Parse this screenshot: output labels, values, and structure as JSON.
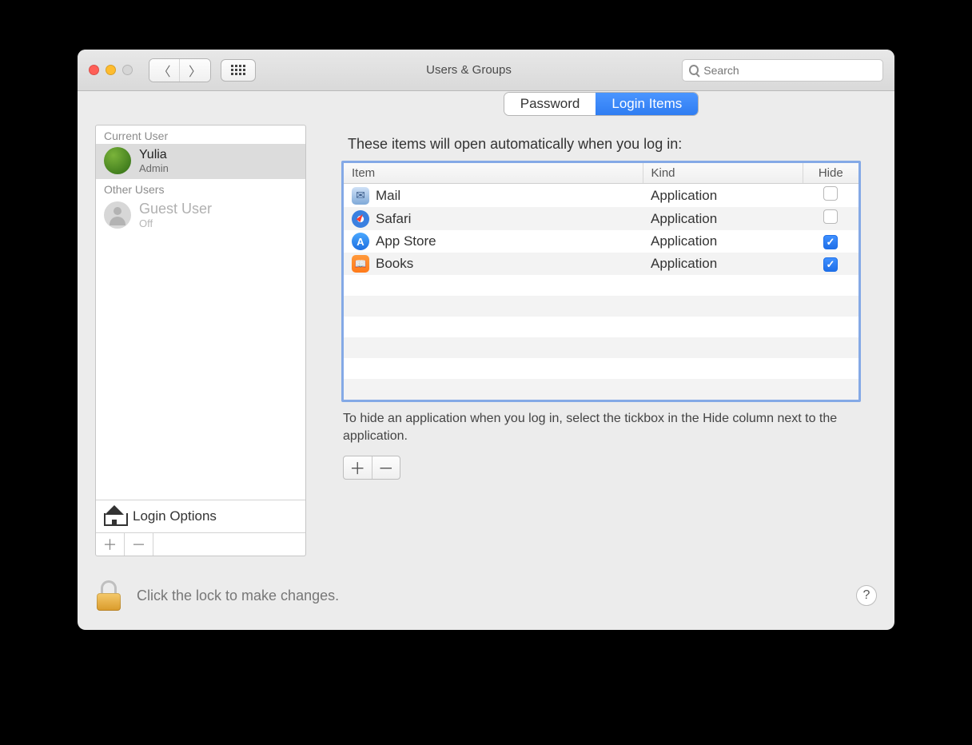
{
  "window": {
    "title": "Users & Groups"
  },
  "search": {
    "placeholder": "Search"
  },
  "sidebar": {
    "section_current": "Current User",
    "section_other": "Other Users",
    "current_user": {
      "name": "Yulia",
      "role": "Admin"
    },
    "guest_user": {
      "name": "Guest User",
      "role": "Off"
    },
    "login_options": "Login Options"
  },
  "tabs": {
    "password": "Password",
    "login_items": "Login Items"
  },
  "main": {
    "caption": "These items will open automatically when you log in:",
    "col_item": "Item",
    "col_kind": "Kind",
    "col_hide": "Hide",
    "rows": [
      {
        "name": "Mail",
        "kind": "Application",
        "hide": false,
        "icon": "mail"
      },
      {
        "name": "Safari",
        "kind": "Application",
        "hide": false,
        "icon": "safari"
      },
      {
        "name": "App Store",
        "kind": "Application",
        "hide": true,
        "icon": "appstore"
      },
      {
        "name": "Books",
        "kind": "Application",
        "hide": true,
        "icon": "books"
      }
    ],
    "hint": "To hide an application when you log in, select the tickbox in the Hide column next to the application."
  },
  "footer": {
    "lock_text": "Click the lock to make changes."
  }
}
